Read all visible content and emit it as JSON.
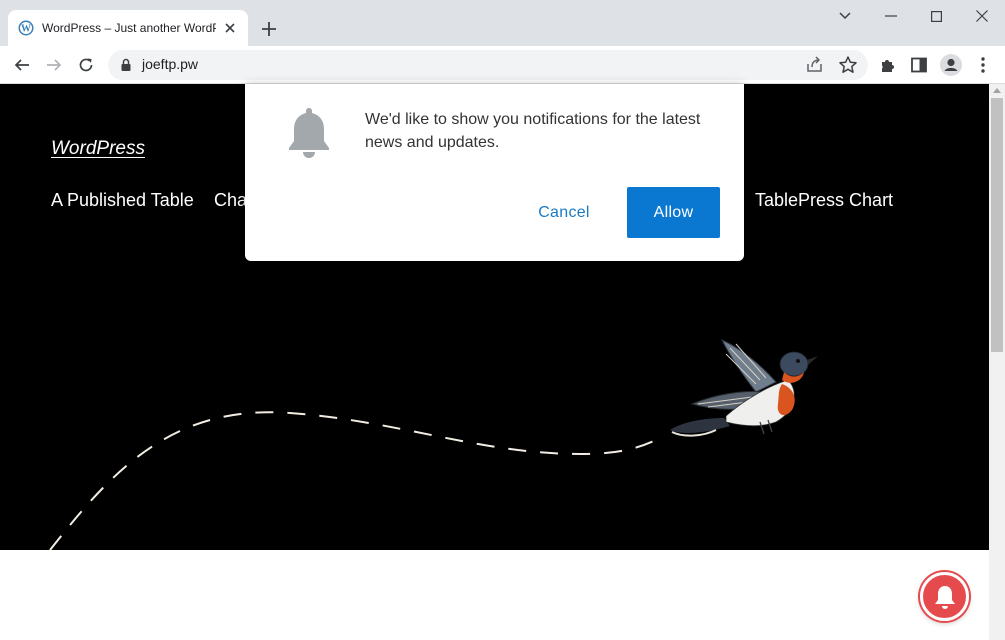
{
  "browser": {
    "tab_title": "WordPress – Just another WordPress site",
    "url": "joeftp.pw"
  },
  "site": {
    "title": "WordPress",
    "nav": [
      "A Published Table",
      "Cha",
      "TablePress Chart"
    ]
  },
  "prompt": {
    "message": "We'd like to show you notifications for the latest news and updates.",
    "cancel_label": "Cancel",
    "allow_label": "Allow"
  },
  "colors": {
    "allow_button": "#0a78d0",
    "cancel_text": "#1a7ac4",
    "bell_fab": "#e54b4d",
    "hero_bg": "#000000"
  },
  "icons": [
    "wordpress-icon",
    "close-icon",
    "plus-icon",
    "chevron-down-icon",
    "minimize-icon",
    "maximize-icon",
    "back-icon",
    "forward-icon",
    "reload-icon",
    "lock-icon",
    "share-icon",
    "star-icon",
    "extensions-icon",
    "side-panel-icon",
    "profile-icon",
    "menu-icon",
    "bell-icon"
  ]
}
